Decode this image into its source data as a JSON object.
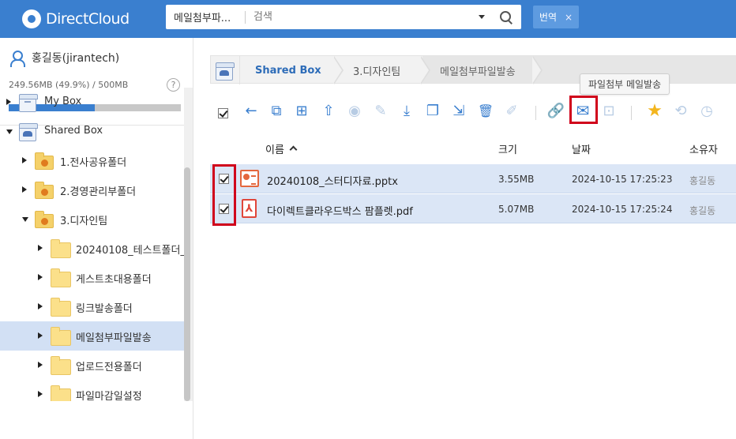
{
  "header": {
    "logo_text": "DirectCloud",
    "search_scope": "메일첨부파...",
    "search_placeholder": "검색",
    "translate_label": "번역",
    "translate_close": "×"
  },
  "sidebar": {
    "user_name": "홍길동(jirantech)",
    "quota_text": "249.56MB (49.9%) / 500MB",
    "quota_percent": 49.9,
    "help_label": "?",
    "tree": [
      {
        "label": "My Box",
        "level": 0,
        "icon": "box-icon",
        "expanded": false
      },
      {
        "label": "Shared Box",
        "level": 0,
        "icon": "shared-box-icon",
        "expanded": true
      },
      {
        "label": "1.전사공유폴더",
        "level": 1,
        "icon": "shared-folder-icon",
        "expanded": false
      },
      {
        "label": "2.경영관리부폴더",
        "level": 1,
        "icon": "shared-folder-icon",
        "expanded": false
      },
      {
        "label": "3.디자인팀",
        "level": 1,
        "icon": "shared-folder-icon",
        "expanded": true
      },
      {
        "label": "20240108_테스트폴더_(",
        "level": 2,
        "icon": "folder-icon",
        "expanded": false
      },
      {
        "label": "게스트초대용폴더",
        "level": 2,
        "icon": "folder-icon",
        "expanded": false
      },
      {
        "label": "링크발송폴더",
        "level": 2,
        "icon": "folder-icon",
        "expanded": false
      },
      {
        "label": "메일첨부파일발송",
        "level": 2,
        "icon": "folder-icon",
        "expanded": false,
        "selected": true
      },
      {
        "label": "업로드전용폴더",
        "level": 2,
        "icon": "folder-icon",
        "expanded": false
      },
      {
        "label": "파일마감일설정",
        "level": 2,
        "icon": "folder-icon",
        "expanded": false
      }
    ]
  },
  "breadcrumb": {
    "items": [
      "Shared Box",
      "3.디자인팀",
      "메일첨부파일발송"
    ]
  },
  "tooltip": {
    "text": "파일첨부 메일발송"
  },
  "toolbar": {
    "icons": [
      {
        "name": "back-arrow-icon",
        "glyph": "←"
      },
      {
        "name": "copy-to-box-icon",
        "glyph": "⧉"
      },
      {
        "name": "new-folder-icon",
        "glyph": "⊞"
      },
      {
        "name": "upload-icon",
        "glyph": "⇧"
      },
      {
        "name": "preview-eye-icon",
        "glyph": "◉"
      },
      {
        "name": "edit-pencil-icon",
        "glyph": "✎"
      },
      {
        "name": "download-icon",
        "glyph": "⤓"
      },
      {
        "name": "copy-icon",
        "glyph": "❐"
      },
      {
        "name": "move-icon",
        "glyph": "⇲"
      },
      {
        "name": "delete-trash-icon",
        "glyph": "🗑"
      },
      {
        "name": "rename-icon",
        "glyph": "✐"
      },
      {
        "name": "link-icon",
        "glyph": "🔗"
      },
      {
        "name": "mail-attach-icon",
        "glyph": "✉"
      },
      {
        "name": "archive-icon",
        "glyph": "⊡"
      },
      {
        "name": "favorite-star-icon",
        "glyph": "★"
      },
      {
        "name": "sync-icon",
        "glyph": "⟲"
      },
      {
        "name": "history-clock-icon",
        "glyph": "◷"
      },
      {
        "name": "tag-icon",
        "glyph": "◇"
      }
    ]
  },
  "list": {
    "columns": {
      "name": "이름",
      "size": "크기",
      "date": "날짜",
      "owner": "소유자"
    },
    "rows": [
      {
        "name": "20240108_스터디자료.pptx",
        "size": "3.55MB",
        "date": "2024-10-15 17:25:23",
        "owner": "홍길동",
        "type": "pptx",
        "checked": true
      },
      {
        "name": "다이렉트클라우드박스 팜플렛.pdf",
        "size": "5.07MB",
        "date": "2024-10-15 17:25:24",
        "owner": "홍길동",
        "type": "pdf",
        "checked": true
      }
    ]
  },
  "colors": {
    "brand": "#3a7fcf",
    "selection": "#dbe6f6",
    "highlight_red": "#d0021b"
  }
}
